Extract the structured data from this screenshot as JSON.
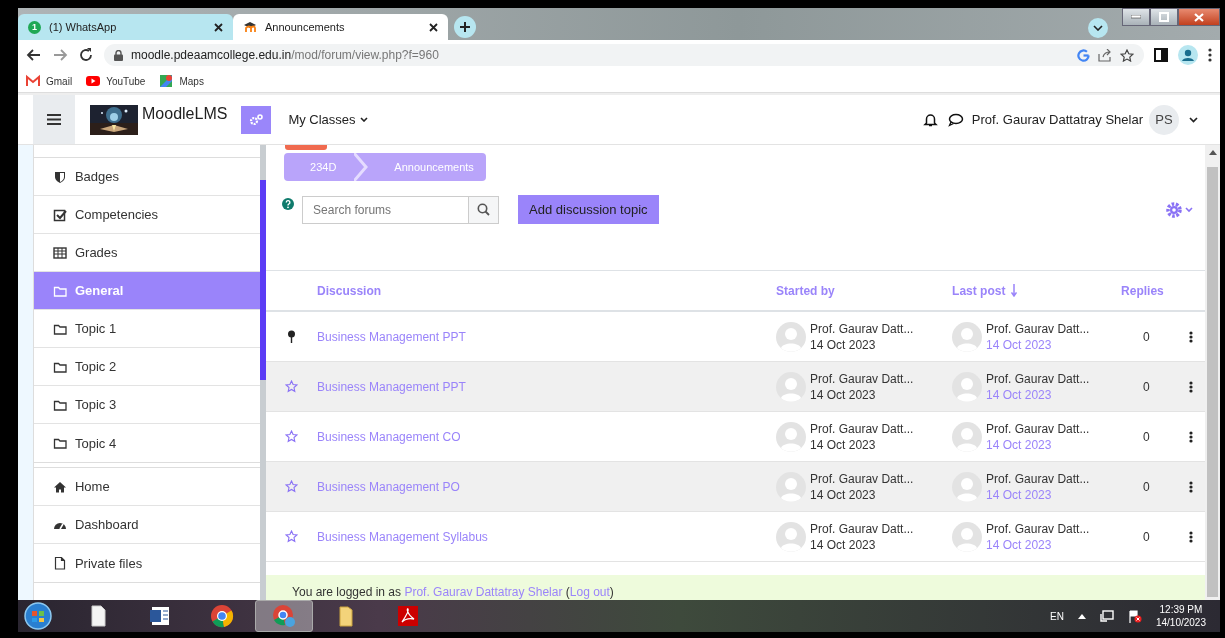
{
  "browser": {
    "tabs": [
      {
        "title": "(1) WhatsApp",
        "kind": "chat",
        "badge": "1",
        "selected": false
      },
      {
        "title": "Announcements",
        "kind": "moodle",
        "selected": true
      }
    ],
    "url_host": "moodle.pdeaamcollege.edu.in",
    "url_path": "/mod/forum/view.php?f=960",
    "bookmarks": [
      {
        "label": "Gmail",
        "kind": "mail"
      },
      {
        "label": "YouTube",
        "kind": "video"
      },
      {
        "label": "Maps",
        "kind": "map"
      }
    ]
  },
  "header": {
    "brand": "MoodleLMS",
    "nav": "My Classes",
    "user": "Prof. Gaurav Dattatray Shelar",
    "initials": "PS"
  },
  "sidebar": {
    "groups": [
      [
        {
          "label": "Badges",
          "kind": "shield",
          "selected": false
        },
        {
          "label": "Competencies",
          "kind": "checkbox",
          "selected": false
        },
        {
          "label": "Grades",
          "kind": "grid",
          "selected": false
        },
        {
          "label": "General",
          "kind": "folder",
          "selected": true
        },
        {
          "label": "Topic 1",
          "kind": "folder",
          "selected": false
        },
        {
          "label": "Topic 2",
          "kind": "folder",
          "selected": false
        },
        {
          "label": "Topic 3",
          "kind": "folder",
          "selected": false
        },
        {
          "label": "Topic 4",
          "kind": "folder",
          "selected": false
        }
      ],
      [
        {
          "label": "Home",
          "kind": "home",
          "selected": false
        },
        {
          "label": "Dashboard",
          "kind": "gauge",
          "selected": false
        },
        {
          "label": "Private files",
          "kind": "file",
          "selected": false
        }
      ]
    ]
  },
  "breadcrumb": [
    "234D",
    "Announcements"
  ],
  "search": {
    "placeholder": "Search forums"
  },
  "add_button": "Add discussion topic",
  "table": {
    "columns": [
      "Discussion",
      "Started by",
      "Last post",
      "Replies"
    ],
    "rows": [
      {
        "title": "Business Management PPT",
        "pinned": true,
        "starter": "Prof. Gaurav Datt...",
        "started": "14 Oct 2023",
        "last_by": "Prof. Gaurav Datt...",
        "last_date": "14 Oct 2023",
        "replies": "0"
      },
      {
        "title": "Business Management PPT",
        "pinned": false,
        "starter": "Prof. Gaurav Datt...",
        "started": "14 Oct 2023",
        "last_by": "Prof. Gaurav Datt...",
        "last_date": "14 Oct 2023",
        "replies": "0"
      },
      {
        "title": "Business Management CO",
        "pinned": false,
        "starter": "Prof. Gaurav Datt...",
        "started": "14 Oct 2023",
        "last_by": "Prof. Gaurav Datt...",
        "last_date": "14 Oct 2023",
        "replies": "0"
      },
      {
        "title": "Business Management PO",
        "pinned": false,
        "starter": "Prof. Gaurav Datt...",
        "started": "14 Oct 2023",
        "last_by": "Prof. Gaurav Datt...",
        "last_date": "14 Oct 2023",
        "replies": "0"
      },
      {
        "title": "Business Management Syllabus",
        "pinned": false,
        "starter": "Prof. Gaurav Datt...",
        "started": "14 Oct 2023",
        "last_by": "Prof. Gaurav Datt...",
        "last_date": "14 Oct 2023",
        "replies": "0"
      }
    ]
  },
  "footer": {
    "prefix": "You are logged in as",
    "user": "Prof. Gaurav Dattatray Shelar",
    "open": "(",
    "logout": "Log out",
    "close": ")"
  },
  "taskbar": {
    "apps": [
      {
        "kind": "file",
        "active": false
      },
      {
        "kind": "word",
        "active": false
      },
      {
        "kind": "chrome",
        "active": false
      },
      {
        "kind": "chrome-profile",
        "active": true
      },
      {
        "kind": "folder",
        "active": false
      },
      {
        "kind": "pdf",
        "active": false
      }
    ],
    "language": "EN",
    "time": "12:39 PM",
    "date": "14/10/2023"
  }
}
